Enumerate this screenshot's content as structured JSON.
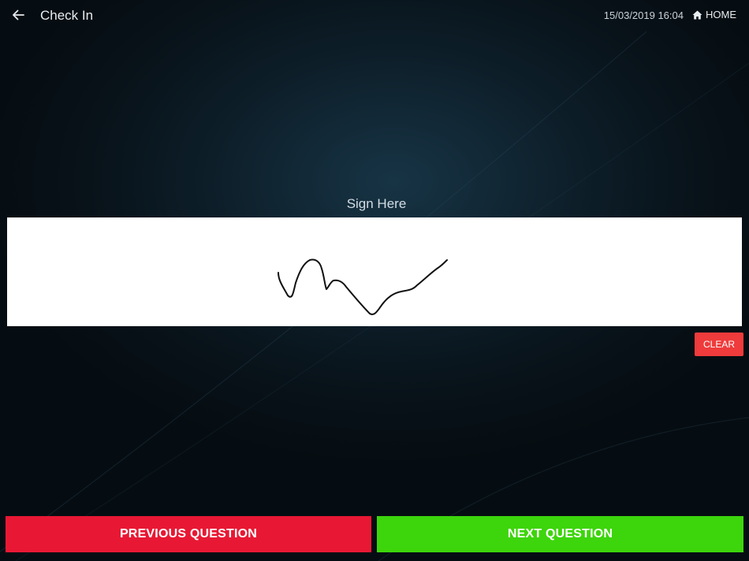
{
  "header": {
    "title": "Check In",
    "datetime": "15/03/2019 16:04",
    "home_label": "HOME"
  },
  "signature": {
    "label": "Sign Here",
    "clear_label": "CLEAR"
  },
  "footer": {
    "previous_label": "PREVIOUS QUESTION",
    "next_label": "NEXT QUESTION"
  },
  "icons": {
    "back": "arrow-left-icon",
    "home": "home-icon"
  },
  "colors": {
    "clear_button": "#ef3b3b",
    "previous_button": "#e81834",
    "next_button": "#3dd50c",
    "signature_pad": "#ffffff"
  }
}
